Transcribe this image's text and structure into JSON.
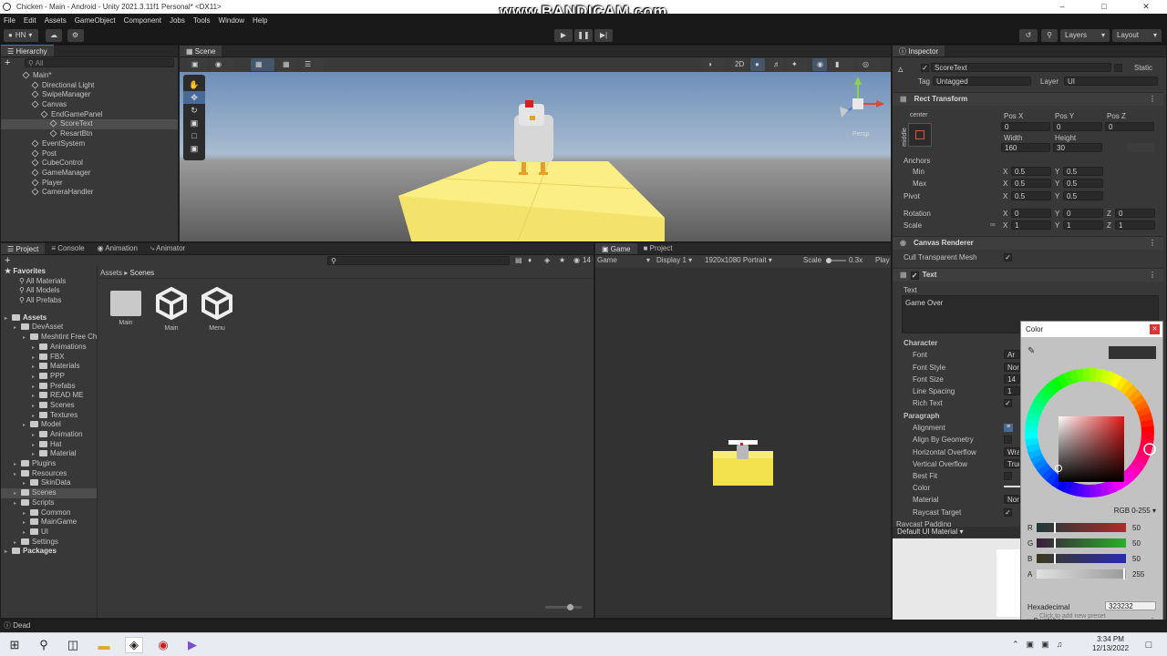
{
  "window": {
    "title": "Chicken - Main - Android - Unity 2021.3.11f1 Personal* <DX11>",
    "watermark": "www.BANDICAM.com"
  },
  "menu": [
    "File",
    "Edit",
    "Assets",
    "GameObject",
    "Component",
    "Jobs",
    "Tools",
    "Window",
    "Help"
  ],
  "toolbar": {
    "account": "HN",
    "layers": "Layers",
    "layout": "Layout"
  },
  "hierarchy": {
    "tab": "Hierarchy",
    "search": "All",
    "items": [
      {
        "label": "Main*",
        "indent": 0,
        "selected": false
      },
      {
        "label": "Directional Light",
        "indent": 1
      },
      {
        "label": "SwipeManager",
        "indent": 1
      },
      {
        "label": "Canvas",
        "indent": 1
      },
      {
        "label": "EndGamePanel",
        "indent": 2
      },
      {
        "label": "ScoreText",
        "indent": 3,
        "selected": true
      },
      {
        "label": "ResartBtn",
        "indent": 3
      },
      {
        "label": "EventSystem",
        "indent": 1
      },
      {
        "label": "Post",
        "indent": 1
      },
      {
        "label": "CubeControl",
        "indent": 1
      },
      {
        "label": "GameManager",
        "indent": 1
      },
      {
        "label": "Player",
        "indent": 1
      },
      {
        "label": "CameraHandler",
        "indent": 1
      }
    ]
  },
  "scene": {
    "tab": "Scene",
    "mode2d": "2D",
    "persp": "Persp"
  },
  "project": {
    "tabs": [
      "Project",
      "Console",
      "Animation",
      "Animator"
    ],
    "count": "14",
    "breadcrumb_root": "Assets",
    "breadcrumb_current": "Scenes",
    "favorites": {
      "title": "Favorites",
      "items": [
        "All Materials",
        "All Models",
        "All Prefabs"
      ]
    },
    "tree": [
      {
        "label": "Assets",
        "indent": 0,
        "bold": true
      },
      {
        "label": "DevAsset",
        "indent": 1
      },
      {
        "label": "Meshtint Free Ch",
        "indent": 2
      },
      {
        "label": "Animations",
        "indent": 3
      },
      {
        "label": "FBX",
        "indent": 3
      },
      {
        "label": "Materials",
        "indent": 3
      },
      {
        "label": "PPP",
        "indent": 3
      },
      {
        "label": "Prefabs",
        "indent": 3
      },
      {
        "label": "READ ME",
        "indent": 3
      },
      {
        "label": "Scenes",
        "indent": 3
      },
      {
        "label": "Textures",
        "indent": 3
      },
      {
        "label": "Model",
        "indent": 2
      },
      {
        "label": "Animation",
        "indent": 3
      },
      {
        "label": "Hat",
        "indent": 3
      },
      {
        "label": "Material",
        "indent": 3
      },
      {
        "label": "Plugins",
        "indent": 1
      },
      {
        "label": "Resources",
        "indent": 1
      },
      {
        "label": "SkinData",
        "indent": 2
      },
      {
        "label": "Scenes",
        "indent": 1,
        "selected": true
      },
      {
        "label": "Scripts",
        "indent": 1
      },
      {
        "label": "Common",
        "indent": 2
      },
      {
        "label": "MainGame",
        "indent": 2
      },
      {
        "label": "UI",
        "indent": 2
      },
      {
        "label": "Settings",
        "indent": 1
      },
      {
        "label": "Packages",
        "indent": 0,
        "bold": true
      }
    ],
    "files": [
      {
        "label": "Main",
        "type": "folder"
      },
      {
        "label": "Main",
        "type": "unity"
      },
      {
        "label": "Menu",
        "type": "unity"
      }
    ]
  },
  "game": {
    "tabs": [
      "Game",
      "Project"
    ],
    "view": "Game",
    "display": "Display 1",
    "resolution": "1920x1080 Portrait",
    "scale_label": "Scale",
    "scale": "0.3x",
    "play": "Play"
  },
  "inspector": {
    "tab": "Inspector",
    "object_name": "ScoreText",
    "static": "Static",
    "tag_label": "Tag",
    "tag": "Untagged",
    "layer_label": "Layer",
    "layer": "UI",
    "rect": {
      "title": "Rect Transform",
      "anchor_preset": "center",
      "side": "middle",
      "posx_l": "Pos X",
      "posy_l": "Pos Y",
      "posz_l": "Pos Z",
      "posx": "0",
      "posy": "0",
      "posz": "0",
      "w_l": "Width",
      "h_l": "Height",
      "w": "160",
      "h": "30",
      "anchors": "Anchors",
      "min": "Min",
      "max": "Max",
      "pivot": "Pivot",
      "minx": "0.5",
      "miny": "0.5",
      "maxx": "0.5",
      "maxy": "0.5",
      "pivx": "0.5",
      "pivy": "0.5",
      "rotation": "Rotation",
      "rx": "0",
      "ry": "0",
      "rz": "0",
      "scale": "Scale",
      "sx": "1",
      "sy": "1",
      "sz": "1",
      "x": "X",
      "y": "Y",
      "z": "Z"
    },
    "canvas_renderer": {
      "title": "Canvas Renderer",
      "cull": "Cull Transparent Mesh"
    },
    "text": {
      "title": "Text",
      "text_label": "Text",
      "value": "Game Over",
      "character": "Character",
      "font": "Font",
      "font_v": "Ar",
      "font_style": "Font Style",
      "font_style_v": "Norm",
      "font_size": "Font Size",
      "font_size_v": "14",
      "line_spacing": "Line Spacing",
      "line_spacing_v": "1",
      "rich_text": "Rich Text",
      "paragraph": "Paragraph",
      "alignment": "Alignment",
      "align_geo": "Align By Geometry",
      "h_overflow": "Horizontal Overflow",
      "h_overflow_v": "Wrap",
      "v_overflow": "Vertical Overflow",
      "v_overflow_v": "Trun",
      "best_fit": "Best Fit",
      "color": "Color",
      "material": "Material",
      "material_v": "None",
      "raycast": "Raycast Target",
      "raycast_pad": "Raycast Padding",
      "default_mat": "Default UI Material"
    }
  },
  "color_picker": {
    "title": "Color",
    "mode": "RGB 0-255",
    "r_label": "R",
    "g_label": "G",
    "b_label": "B",
    "a_label": "A",
    "r": "50",
    "g": "50",
    "b": "50",
    "a": "255",
    "hex_label": "Hexadecimal",
    "hex": "323232",
    "swatches": "Swatches",
    "add_preset": "Click to add new preset"
  },
  "status": {
    "text": "Dead"
  },
  "taskbar": {
    "time": "3:34 PM",
    "date": "12/13/2022"
  }
}
